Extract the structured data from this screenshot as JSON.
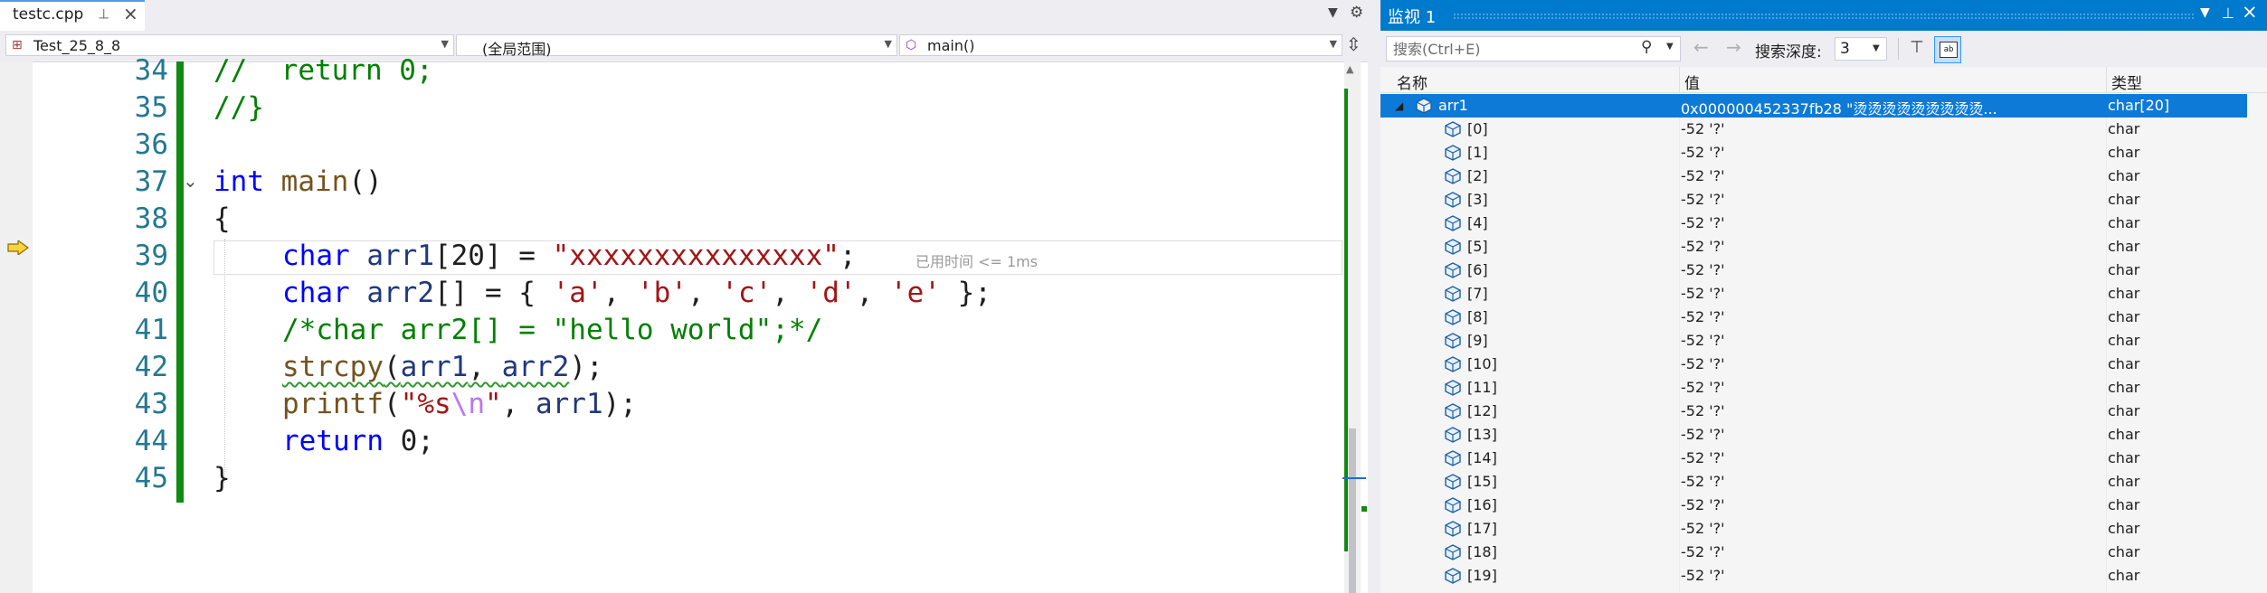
{
  "editor": {
    "tab": {
      "title": "testc.cpp"
    },
    "nav": {
      "project": "Test_25_8_8",
      "scope": "(全局范围)",
      "member": "main()"
    },
    "elapsed_hint": "已用时间 <= 1ms",
    "line_numbers": [
      "34",
      "35",
      "36",
      "37",
      "38",
      "39",
      "40",
      "41",
      "42",
      "43",
      "44",
      "45"
    ],
    "code": {
      "l34": {
        "a": "//  return 0;"
      },
      "l35": {
        "a": "//}"
      },
      "l37": {
        "kw": "int",
        "fn": "main",
        "rest": "()"
      },
      "l38": {
        "a": "{"
      },
      "l39": {
        "kw": "char",
        "var": "arr1",
        "p1": "[20] = ",
        "str": "\"xxxxxxxxxxxxxxx\"",
        "p2": ";"
      },
      "l40": {
        "kw": "char",
        "var": "arr2",
        "p1": "[] = { ",
        "s1": "'a'",
        "c1": ", ",
        "s2": "'b'",
        "c2": ", ",
        "s3": "'c'",
        "c3": ", ",
        "s4": "'d'",
        "c4": ", ",
        "s5": "'e'",
        "p2": " };"
      },
      "l41": {
        "a": "/*char arr2[] = \"hello world\";*/"
      },
      "l42": {
        "fn": "strcpy",
        "p1": "(",
        "v1": "arr1",
        "c1": ", ",
        "v2": "arr2",
        "p2": ");"
      },
      "l43": {
        "fn": "printf",
        "p1": "(",
        "s1": "\"%s",
        "esc": "\\n",
        "s2": "\"",
        "c1": ", ",
        "v1": "arr1",
        "p2": ");"
      },
      "l44": {
        "kw": "return",
        "rest": " 0;"
      },
      "l45": {
        "a": "}"
      }
    }
  },
  "watch": {
    "title": "监视 1",
    "search_placeholder": "搜索(Ctrl+E)",
    "depth_label": "搜索深度:",
    "depth_value": "3",
    "columns": {
      "name": "名称",
      "value": "值",
      "type": "类型"
    },
    "root": {
      "name": "arr1",
      "value": "0x000000452337fb28 \"烫烫烫烫烫烫烫烫烫...",
      "type": "char[20]"
    },
    "items": [
      {
        "name": "[0]",
        "value": "-52 '?'",
        "type": "char"
      },
      {
        "name": "[1]",
        "value": "-52 '?'",
        "type": "char"
      },
      {
        "name": "[2]",
        "value": "-52 '?'",
        "type": "char"
      },
      {
        "name": "[3]",
        "value": "-52 '?'",
        "type": "char"
      },
      {
        "name": "[4]",
        "value": "-52 '?'",
        "type": "char"
      },
      {
        "name": "[5]",
        "value": "-52 '?'",
        "type": "char"
      },
      {
        "name": "[6]",
        "value": "-52 '?'",
        "type": "char"
      },
      {
        "name": "[7]",
        "value": "-52 '?'",
        "type": "char"
      },
      {
        "name": "[8]",
        "value": "-52 '?'",
        "type": "char"
      },
      {
        "name": "[9]",
        "value": "-52 '?'",
        "type": "char"
      },
      {
        "name": "[10]",
        "value": "-52 '?'",
        "type": "char"
      },
      {
        "name": "[11]",
        "value": "-52 '?'",
        "type": "char"
      },
      {
        "name": "[12]",
        "value": "-52 '?'",
        "type": "char"
      },
      {
        "name": "[13]",
        "value": "-52 '?'",
        "type": "char"
      },
      {
        "name": "[14]",
        "value": "-52 '?'",
        "type": "char"
      },
      {
        "name": "[15]",
        "value": "-52 '?'",
        "type": "char"
      },
      {
        "name": "[16]",
        "value": "-52 '?'",
        "type": "char"
      },
      {
        "name": "[17]",
        "value": "-52 '?'",
        "type": "char"
      },
      {
        "name": "[18]",
        "value": "-52 '?'",
        "type": "char"
      },
      {
        "name": "[19]",
        "value": "-52 '?'",
        "type": "char"
      }
    ]
  },
  "colors": {
    "accent": "#007acc",
    "selection": "#0e7ad8",
    "keyword": "#0000ff",
    "comment": "#008000",
    "string": "#a31515",
    "change_bar": "#108a10"
  }
}
